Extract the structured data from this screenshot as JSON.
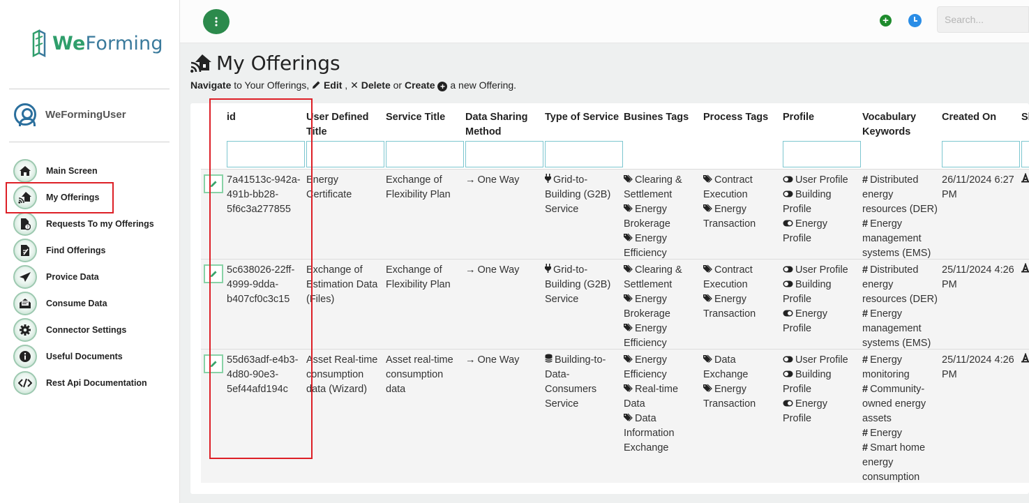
{
  "sidebar": {
    "brand_a": "We",
    "brand_b": "Forming",
    "user": "WeFormingUser",
    "items": [
      {
        "label": "Main Screen",
        "icon": "home-icon"
      },
      {
        "label": "My Offerings",
        "icon": "house-signal-icon"
      },
      {
        "label": "Requests To my Offerings",
        "icon": "file-request-icon"
      },
      {
        "label": "Find Offerings",
        "icon": "file-search-icon"
      },
      {
        "label": "Provice Data",
        "icon": "paper-plane-icon"
      },
      {
        "label": "Consume Data",
        "icon": "envelope-open-icon"
      },
      {
        "label": "Connector Settings",
        "icon": "gear-icon"
      },
      {
        "label": "Useful Documents",
        "icon": "info-icon"
      },
      {
        "label": "Rest Api Documentation",
        "icon": "code-icon"
      }
    ]
  },
  "topbar": {
    "menu_icon": "vertical-dots-icon",
    "search_placeholder": "Search..."
  },
  "page": {
    "title": "My Offerings",
    "sub_navigate": "Navigate",
    "sub_to": " to Your Offerings, ",
    "sub_edit": "Edit",
    "sub_comma": " , ",
    "sub_delete": "Delete",
    "sub_or": " or ",
    "sub_create": "Create",
    "sub_end": " a new Offering."
  },
  "table": {
    "columns": [
      "id",
      "User Defined Title",
      "Service Title",
      "Data Sharing Method",
      "Type of Service",
      "Busines Tags",
      "Process Tags",
      "Profile",
      "Vocabulary Keywords",
      "Created On",
      "Sh"
    ],
    "rows": [
      {
        "id": [
          "7a41513c-942a-",
          "491b-bb28-",
          "5f6c3a277855"
        ],
        "user_title": [
          "Energy",
          "Certificate"
        ],
        "service_title": [
          "Exchange of",
          "Flexibility Plan"
        ],
        "method": "One Way",
        "type_icon": "plug-icon",
        "type": [
          "Grid-to-",
          "Building (G2B)",
          "Service"
        ],
        "busines": [
          {
            "tag": true,
            "text": "Clearing &"
          },
          {
            "tag": false,
            "text": "Settlement"
          },
          {
            "tag": true,
            "text": "Energy"
          },
          {
            "tag": false,
            "text": "Brokerage"
          },
          {
            "tag": true,
            "text": "Energy"
          },
          {
            "tag": false,
            "text": "Efficiency"
          }
        ],
        "process": [
          {
            "tag": true,
            "text": "Contract"
          },
          {
            "tag": false,
            "text": "Execution"
          },
          {
            "tag": true,
            "text": "Energy"
          },
          {
            "tag": false,
            "text": "Transaction"
          }
        ],
        "profile": [
          {
            "icon": "toggle-off",
            "text": "User Profile"
          },
          {
            "icon": "toggle-off",
            "text": "Building"
          },
          {
            "icon": "",
            "text": "Profile"
          },
          {
            "icon": "toggle-on",
            "text": "Energy"
          },
          {
            "icon": "",
            "text": "Profile"
          }
        ],
        "vocab": [
          {
            "hash": true,
            "text": "Distributed"
          },
          {
            "hash": false,
            "text": "energy"
          },
          {
            "hash": false,
            "text": "resources (DER)"
          },
          {
            "hash": true,
            "text": "Energy"
          },
          {
            "hash": false,
            "text": "management"
          },
          {
            "hash": false,
            "text": "systems (EMS)"
          }
        ],
        "created": [
          "26/11/2024 6:27",
          "PM"
        ]
      },
      {
        "id": [
          "5c638026-22ff-",
          "4999-9dda-",
          "b407cf0c3c15"
        ],
        "user_title": [
          "Exchange of",
          "Estimation Data",
          "(Files)"
        ],
        "service_title": [
          "Exchange of",
          "Flexibility Plan"
        ],
        "method": "One Way",
        "type_icon": "plug-icon",
        "type": [
          "Grid-to-",
          "Building (G2B)",
          "Service"
        ],
        "busines": [
          {
            "tag": true,
            "text": "Clearing &"
          },
          {
            "tag": false,
            "text": "Settlement"
          },
          {
            "tag": true,
            "text": "Energy"
          },
          {
            "tag": false,
            "text": "Brokerage"
          },
          {
            "tag": true,
            "text": "Energy"
          },
          {
            "tag": false,
            "text": "Efficiency"
          }
        ],
        "process": [
          {
            "tag": true,
            "text": "Contract"
          },
          {
            "tag": false,
            "text": "Execution"
          },
          {
            "tag": true,
            "text": "Energy"
          },
          {
            "tag": false,
            "text": "Transaction"
          }
        ],
        "profile": [
          {
            "icon": "toggle-off",
            "text": "User Profile"
          },
          {
            "icon": "toggle-off",
            "text": "Building"
          },
          {
            "icon": "",
            "text": "Profile"
          },
          {
            "icon": "toggle-on",
            "text": "Energy"
          },
          {
            "icon": "",
            "text": "Profile"
          }
        ],
        "vocab": [
          {
            "hash": true,
            "text": "Distributed"
          },
          {
            "hash": false,
            "text": "energy"
          },
          {
            "hash": false,
            "text": "resources (DER)"
          },
          {
            "hash": true,
            "text": "Energy"
          },
          {
            "hash": false,
            "text": "management"
          },
          {
            "hash": false,
            "text": "systems (EMS)"
          }
        ],
        "created": [
          "25/11/2024 4:26",
          "PM"
        ]
      },
      {
        "id": [
          "55d63adf-e4b3-",
          "4d80-90e3-",
          "5ef44afd194c"
        ],
        "user_title": [
          "Asset Real-time",
          "consumption",
          "data (Wizard)"
        ],
        "service_title": [
          "Asset real-time",
          "consumption",
          "data"
        ],
        "method": "One Way",
        "type_icon": "database-icon",
        "type": [
          "Building-to-",
          "Data-",
          "Consumers",
          "Service"
        ],
        "busines": [
          {
            "tag": true,
            "text": "Energy"
          },
          {
            "tag": false,
            "text": "Efficiency"
          },
          {
            "tag": true,
            "text": "Real-time"
          },
          {
            "tag": false,
            "text": "Data"
          },
          {
            "tag": true,
            "text": "Data"
          },
          {
            "tag": false,
            "text": "Information"
          },
          {
            "tag": false,
            "text": "Exchange"
          }
        ],
        "process": [
          {
            "tag": true,
            "text": "Data"
          },
          {
            "tag": false,
            "text": "Exchange"
          },
          {
            "tag": true,
            "text": "Energy"
          },
          {
            "tag": false,
            "text": "Transaction"
          }
        ],
        "profile": [
          {
            "icon": "toggle-off",
            "text": "User Profile"
          },
          {
            "icon": "toggle-off",
            "text": "Building"
          },
          {
            "icon": "",
            "text": "Profile"
          },
          {
            "icon": "toggle-on",
            "text": "Energy"
          },
          {
            "icon": "",
            "text": "Profile"
          }
        ],
        "vocab": [
          {
            "hash": true,
            "text": "Energy"
          },
          {
            "hash": false,
            "text": "monitoring"
          },
          {
            "hash": true,
            "text": "Community-"
          },
          {
            "hash": false,
            "text": "owned energy"
          },
          {
            "hash": false,
            "text": "assets"
          },
          {
            "hash": true,
            "text": "Energy"
          },
          {
            "hash": true,
            "text": "Smart home"
          },
          {
            "hash": false,
            "text": "energy"
          },
          {
            "hash": false,
            "text": "consumption"
          }
        ],
        "created": [
          "25/11/2024 4:26",
          "PM"
        ]
      }
    ]
  }
}
